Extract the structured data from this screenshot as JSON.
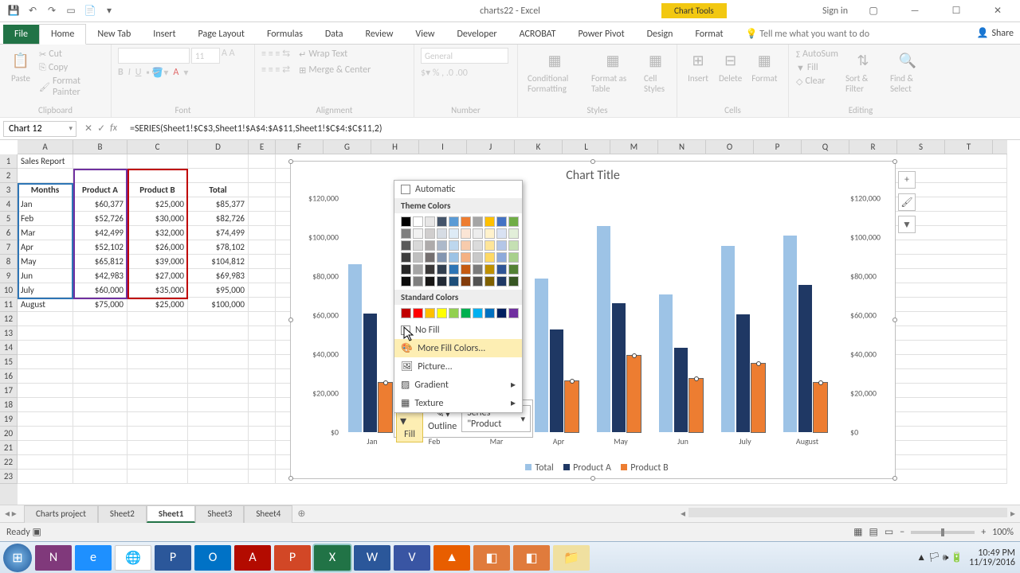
{
  "app": {
    "title": "charts22 - Excel",
    "chart_tools": "Chart Tools",
    "signin": "Sign in"
  },
  "tabs": {
    "file": "File",
    "home": "Home",
    "newtab": "New Tab",
    "insert": "Insert",
    "pagelayout": "Page Layout",
    "formulas": "Formulas",
    "data": "Data",
    "review": "Review",
    "view": "View",
    "developer": "Developer",
    "acrobat": "ACROBAT",
    "powerpivot": "Power Pivot",
    "design": "Design",
    "format": "Format",
    "tellme": "Tell me what you want to do",
    "share": "Share"
  },
  "ribbon": {
    "clipboard": {
      "paste": "Paste",
      "cut": "Cut",
      "copy": "Copy",
      "painter": "Format Painter",
      "label": "Clipboard"
    },
    "font": {
      "size": "11",
      "label": "Font"
    },
    "alignment": {
      "wrap": "Wrap Text",
      "merge": "Merge & Center",
      "label": "Alignment"
    },
    "number": {
      "general": "General",
      "label": "Number"
    },
    "styles": {
      "cond": "Conditional Formatting",
      "table": "Format as Table",
      "cell": "Cell Styles",
      "label": "Styles"
    },
    "cells": {
      "insert": "Insert",
      "delete": "Delete",
      "format": "Format",
      "label": "Cells"
    },
    "editing": {
      "autosum": "AutoSum",
      "fill": "Fill",
      "clear": "Clear",
      "sort": "Sort & Filter",
      "find": "Find & Select",
      "label": "Editing"
    }
  },
  "namebox": "Chart 12",
  "formula": "=SERIES(Sheet1!$C$3,Sheet1!$A$4:$A$11,Sheet1!$C$4:$C$11,2)",
  "cols": [
    "A",
    "B",
    "C",
    "D",
    "E",
    "F",
    "G",
    "H",
    "I",
    "J",
    "K",
    "L",
    "M",
    "N",
    "O",
    "P",
    "Q",
    "R",
    "S",
    "T"
  ],
  "table": {
    "title": "Sales Report",
    "headers": {
      "a": "Months",
      "b": "Product A",
      "c": "Product B",
      "d": "Total"
    },
    "rows": [
      {
        "m": "Jan",
        "a": "$60,377",
        "b": "$25,000",
        "d": "$85,377"
      },
      {
        "m": "Feb",
        "a": "$52,726",
        "b": "$30,000",
        "d": "$82,726"
      },
      {
        "m": "Mar",
        "a": "$42,499",
        "b": "$32,000",
        "d": "$74,499"
      },
      {
        "m": "Apr",
        "a": "$52,102",
        "b": "$26,000",
        "d": "$78,102"
      },
      {
        "m": "May",
        "a": "$65,812",
        "b": "$39,000",
        "d": "$104,812"
      },
      {
        "m": "Jun",
        "a": "$42,983",
        "b": "$27,000",
        "d": "$69,983"
      },
      {
        "m": "July",
        "a": "$60,000",
        "b": "$35,000",
        "d": "$95,000"
      },
      {
        "m": "August",
        "a": "$75,000",
        "b": "$25,000",
        "d": "$100,000"
      }
    ]
  },
  "chart_data": {
    "type": "bar",
    "title": "Chart Title",
    "categories": [
      "Jan",
      "Feb",
      "Mar",
      "Apr",
      "May",
      "Jun",
      "July",
      "August"
    ],
    "series": [
      {
        "name": "Total",
        "values": [
          85377,
          82726,
          74499,
          78102,
          104812,
          69983,
          95000,
          100000
        ],
        "color": "#9dc3e6"
      },
      {
        "name": "Product A",
        "values": [
          60377,
          52726,
          42499,
          52102,
          65812,
          42983,
          60000,
          75000
        ],
        "color": "#1f3864"
      },
      {
        "name": "Product B",
        "values": [
          25000,
          30000,
          32000,
          26000,
          39000,
          27000,
          35000,
          25000
        ],
        "color": "#ed7d31"
      }
    ],
    "ylabel": "",
    "xlabel": "",
    "ylim": [
      0,
      120000
    ],
    "yticks": [
      "$0",
      "$20,000",
      "$40,000",
      "$60,000",
      "$80,000",
      "$100,000",
      "$120,000"
    ]
  },
  "color_popup": {
    "automatic": "Automatic",
    "theme": "Theme Colors",
    "standard": "Standard Colors",
    "nofill": "No Fill",
    "more": "More Fill Colors...",
    "picture": "Picture...",
    "gradient": "Gradient",
    "texture": "Texture",
    "theme_row": [
      "#000000",
      "#ffffff",
      "#e7e6e6",
      "#44546a",
      "#5b9bd5",
      "#ed7d31",
      "#a5a5a5",
      "#ffc000",
      "#4472c4",
      "#70ad47"
    ],
    "theme_shades": [
      [
        "#7f7f7f",
        "#f2f2f2",
        "#d0cece",
        "#d6dce4",
        "#deebf6",
        "#fbe5d5",
        "#ededed",
        "#fff2cc",
        "#d9e2f3",
        "#e2efd9"
      ],
      [
        "#595959",
        "#d8d8d8",
        "#aeabab",
        "#adb9ca",
        "#bdd7ee",
        "#f7cbac",
        "#dbdbdb",
        "#fee599",
        "#b4c6e7",
        "#c5e0b3"
      ],
      [
        "#3f3f3f",
        "#bfbfbf",
        "#757070",
        "#8496b0",
        "#9cc3e5",
        "#f4b183",
        "#c9c9c9",
        "#ffd965",
        "#8eaadb",
        "#a8d08d"
      ],
      [
        "#262626",
        "#a5a5a5",
        "#3a3838",
        "#323f4f",
        "#2e75b5",
        "#c55a11",
        "#7b7b7b",
        "#bf9000",
        "#2f5496",
        "#538135"
      ],
      [
        "#0c0c0c",
        "#7f7f7f",
        "#171616",
        "#222a35",
        "#1e4e79",
        "#833c0b",
        "#525252",
        "#7f6000",
        "#1f3864",
        "#375623"
      ]
    ],
    "standard_row": [
      "#c00000",
      "#ff0000",
      "#ffc000",
      "#ffff00",
      "#92d050",
      "#00b050",
      "#00b0f0",
      "#0070c0",
      "#002060",
      "#7030a0"
    ]
  },
  "mini": {
    "fill": "Fill",
    "outline": "Outline",
    "series": "Series \"Product"
  },
  "sheets": {
    "tabs": [
      "Charts project",
      "Sheet2",
      "Sheet1",
      "Sheet3",
      "Sheet4"
    ],
    "active": 2
  },
  "status": {
    "ready": "Ready",
    "zoom": "100%"
  },
  "tray": {
    "time": "10:49 PM",
    "date": "11/19/2016"
  }
}
